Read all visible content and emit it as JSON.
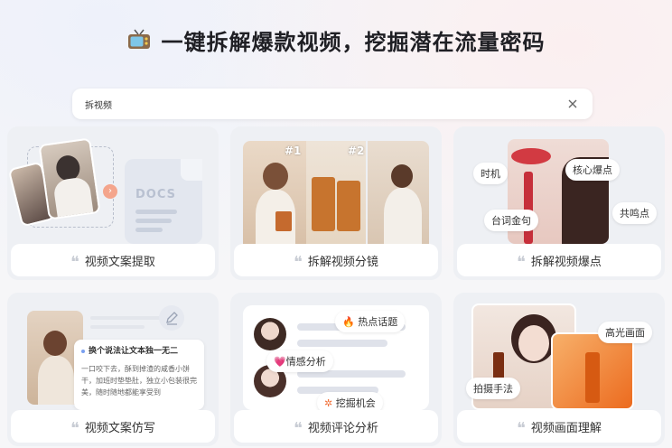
{
  "header": {
    "title": "一键拆解爆款视频，挖掘潜在流量密码",
    "icon": "tv-icon"
  },
  "search": {
    "value": "拆视频"
  },
  "cards": [
    {
      "label": "视频文案提取",
      "docs_text": "DOCS"
    },
    {
      "label": "拆解视频分镜",
      "shot1": "#1",
      "shot2": "#2"
    },
    {
      "label": "拆解视频爆点",
      "tags": [
        "时机",
        "核心爆点",
        "台词金句",
        "共鸣点"
      ]
    },
    {
      "label": "视频文案仿写",
      "popup_title": "换个说法让文本独一无二",
      "popup_text": "一口咬下去，酥到掉渣的咸香小饼干，加班时垫垫肚，独立小包装很完美，随时随地都能享受到"
    },
    {
      "label": "视频评论分析",
      "tags": [
        "热点话题",
        "情感分析",
        "挖掘机会"
      ]
    },
    {
      "label": "视频画面理解",
      "tags": [
        "高光画面",
        "拍摄手法"
      ]
    }
  ],
  "colors": {
    "accent": "#f07a4a",
    "tag_bg": "#ffffff",
    "card_bg": "#eef0f4"
  }
}
